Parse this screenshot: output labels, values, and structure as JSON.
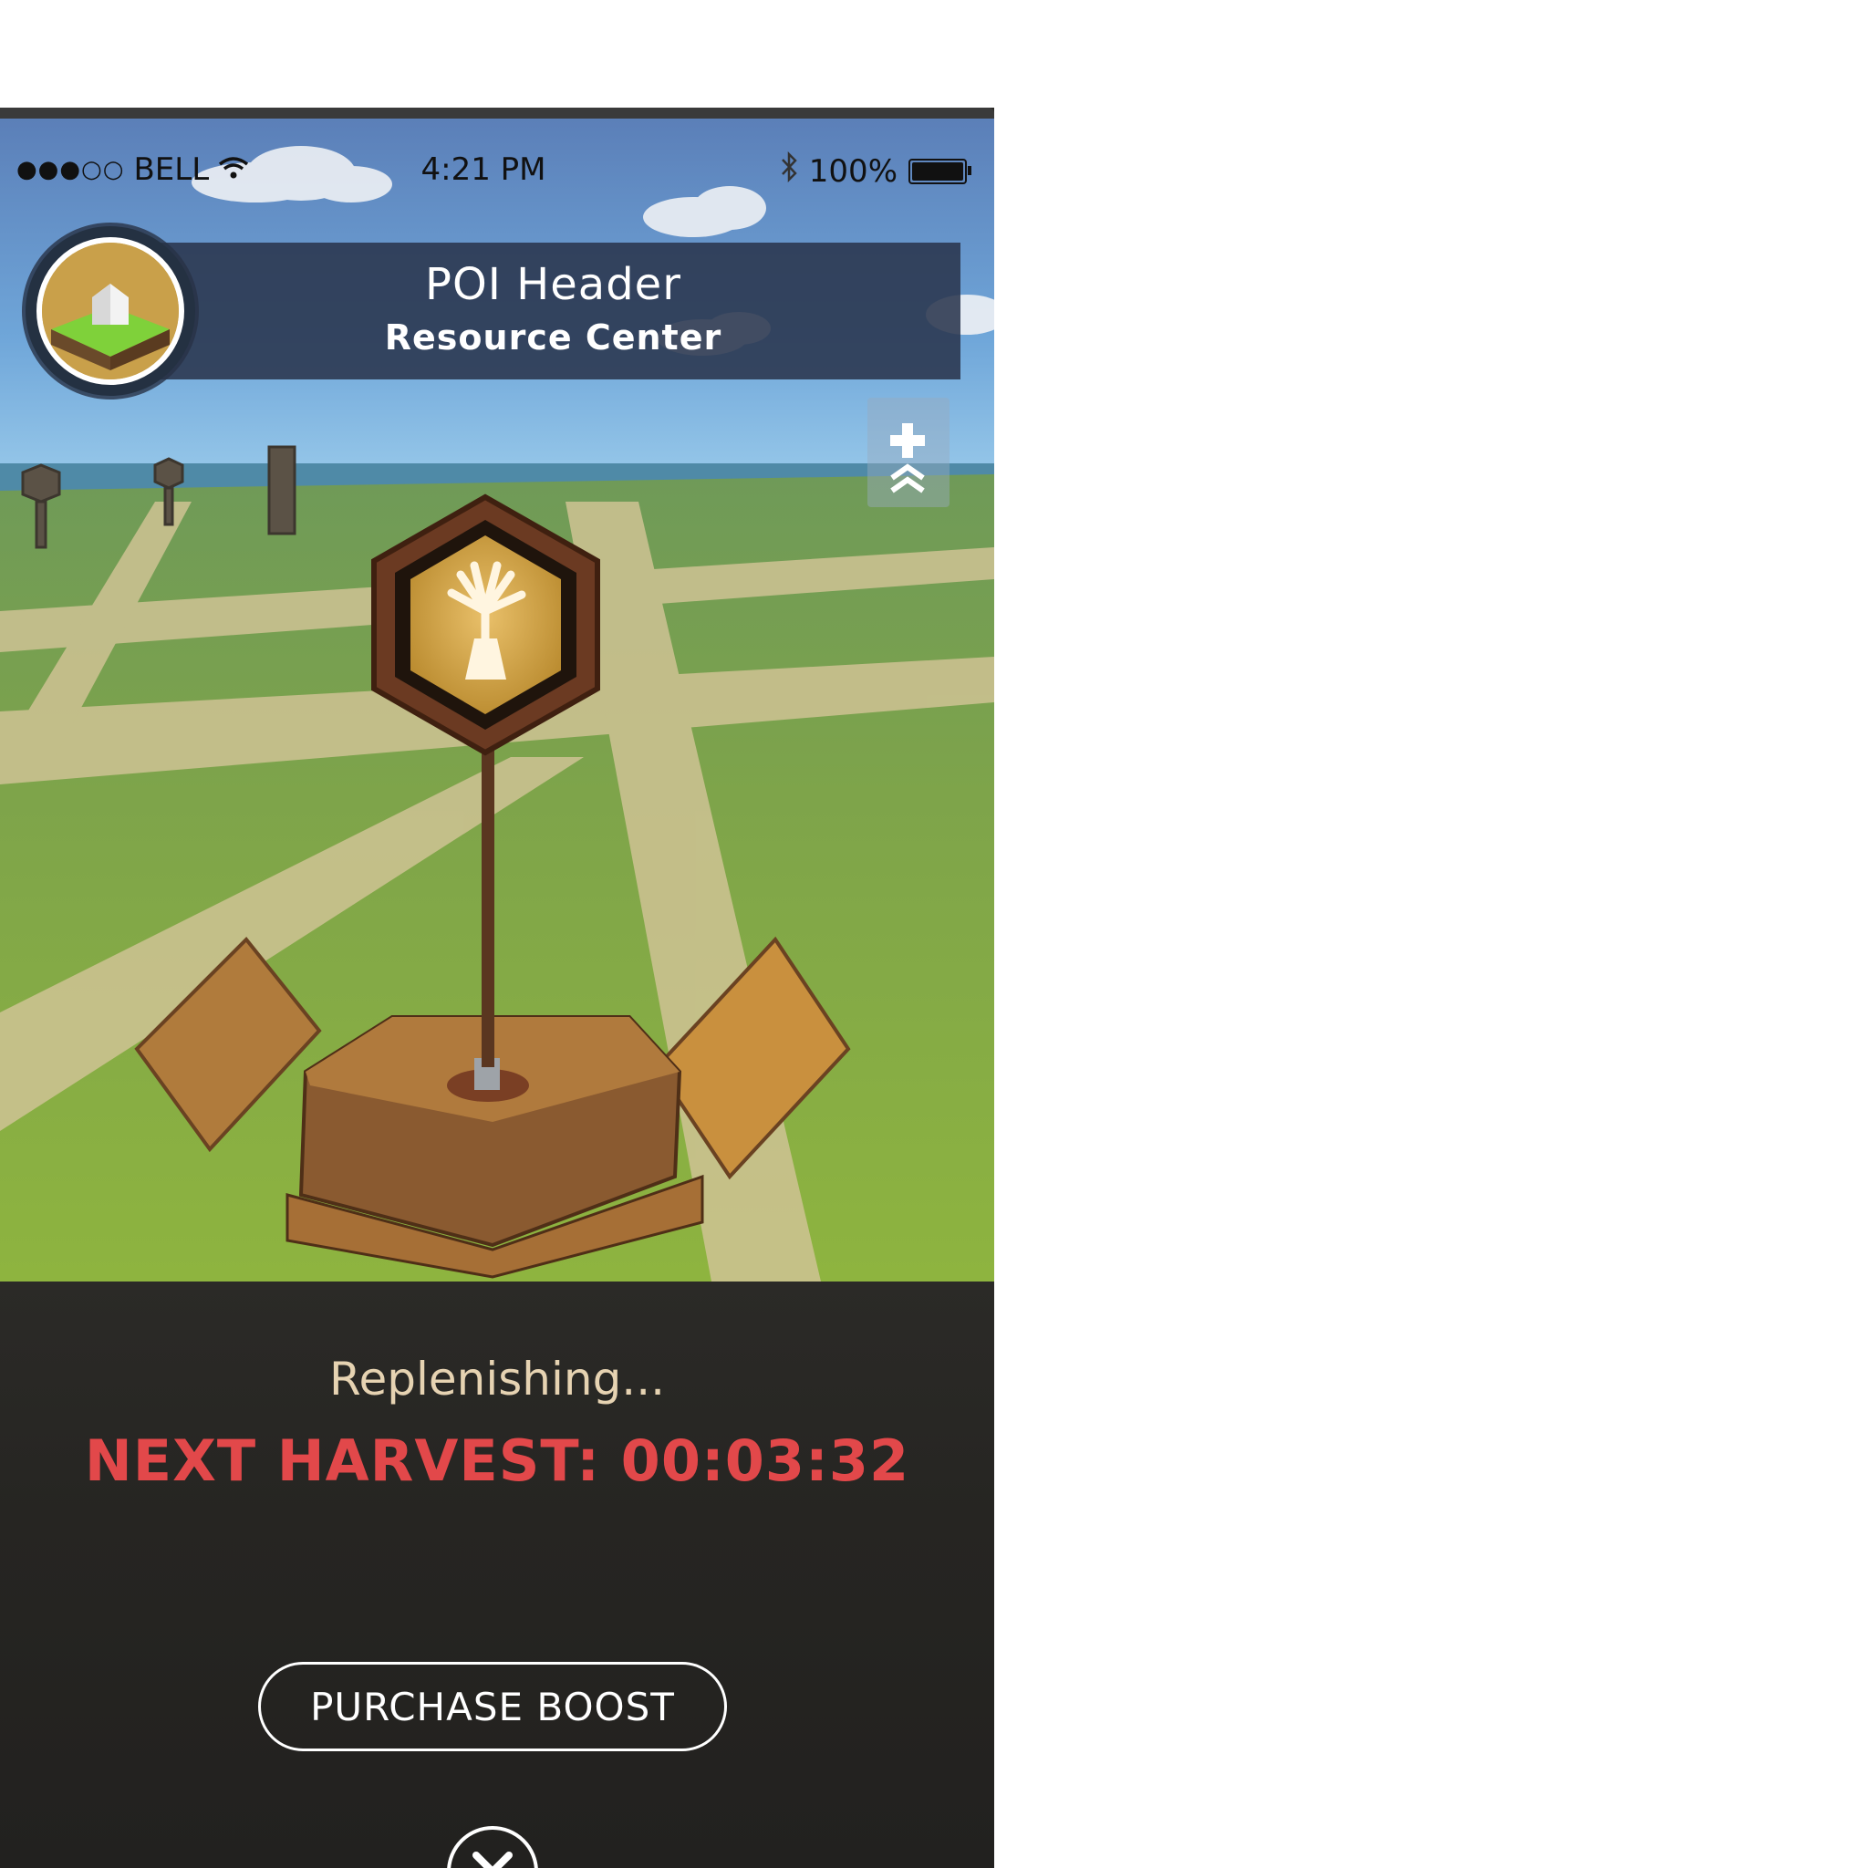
{
  "status_bar": {
    "carrier": "BELL",
    "time": "4:21 PM",
    "battery": "100%",
    "battery_level": 1.0,
    "signal_bars_filled": 3,
    "signal_bars_total": 5
  },
  "poi": {
    "title": "POI Header",
    "subtitle": "Resource Center",
    "avatar_icon": "house-on-tile-icon"
  },
  "map_controls": {
    "zoom_icon": "plus-icon",
    "recenter_icon": "double-chevron-up-icon"
  },
  "scene": {
    "signpost_icon": "wheat-bundle-icon"
  },
  "panel": {
    "status_text": "Replenishing...",
    "timer_text": "NEXT HARVEST: 00:03:32",
    "boost_label": "PURCHASE BOOST",
    "close_icon": "close-icon"
  },
  "colors": {
    "timer_red": "#e2484a",
    "status_cream": "#e6d3b2",
    "banner_navy": "#2a364d",
    "panel_dark": "#262522"
  }
}
